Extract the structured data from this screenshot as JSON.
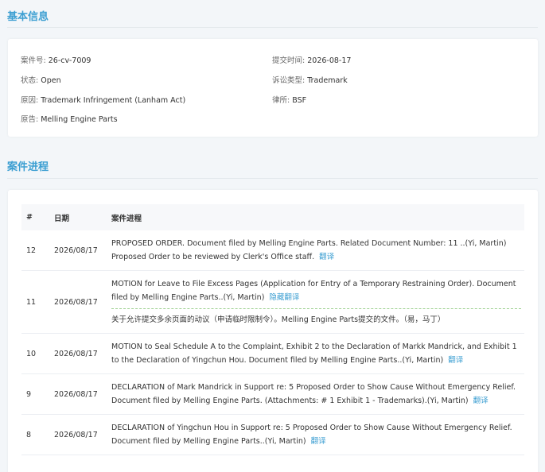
{
  "basic": {
    "title": "基本信息",
    "case_no_label": "案件号:",
    "case_no": "26-cv-7009",
    "submit_label": "提交时间:",
    "submit": "2026-08-17",
    "status_label": "状态:",
    "status": "Open",
    "type_label": "诉讼类型:",
    "type": "Trademark",
    "cause_label": "原因:",
    "cause": "Trademark Infringement (Lanham Act)",
    "firm_label": "律所:",
    "firm": "BSF",
    "plaintiff_label": "原告:",
    "plaintiff": "Melling Engine Parts"
  },
  "progress": {
    "title": "案件进程",
    "headers": {
      "num": "#",
      "date": "日期",
      "entry": "案件进程"
    },
    "rows": [
      {
        "num": "12",
        "date": "2026/08/17",
        "text": "PROPOSED ORDER. Document filed by Melling Engine Parts. Related Document Number: 11 ..(Yi, Martin) Proposed Order to be reviewed by Clerk's Office staff.",
        "link": "翻译"
      },
      {
        "num": "11",
        "date": "2026/08/17",
        "text": "MOTION for Leave to File Excess Pages (Application for Entry of a Temporary Restraining Order). Document filed by Melling Engine Parts..(Yi, Martin)",
        "link": "隐藏翻译",
        "translation": "关于允许提交多余页面的动议（申请临时限制令）。Melling Engine Parts提交的文件。（易，马丁）"
      },
      {
        "num": "10",
        "date": "2026/08/17",
        "text": "MOTION to Seal Schedule A to the Complaint, Exhibit 2 to the Declaration of Markk Mandrick, and Exhibit 1 to the Declaration of Yingchun Hou. Document filed by Melling Engine Parts..(Yi, Martin)",
        "link": "翻译"
      },
      {
        "num": "9",
        "date": "2026/08/17",
        "text": "DECLARATION of Mark Mandrick in Support re: 5 Proposed Order to Show Cause Without Emergency Relief. Document filed by Melling Engine Parts. (Attachments: # 1 Exhibit 1 - Trademarks).(Yi, Martin)",
        "link": "翻译"
      },
      {
        "num": "8",
        "date": "2026/08/17",
        "text": "DECLARATION of Yingchun Hou in Support re: 5 Proposed Order to Show Cause Without Emergency Relief. Document filed by Melling Engine Parts..(Yi, Martin)",
        "link": "翻译"
      }
    ]
  }
}
